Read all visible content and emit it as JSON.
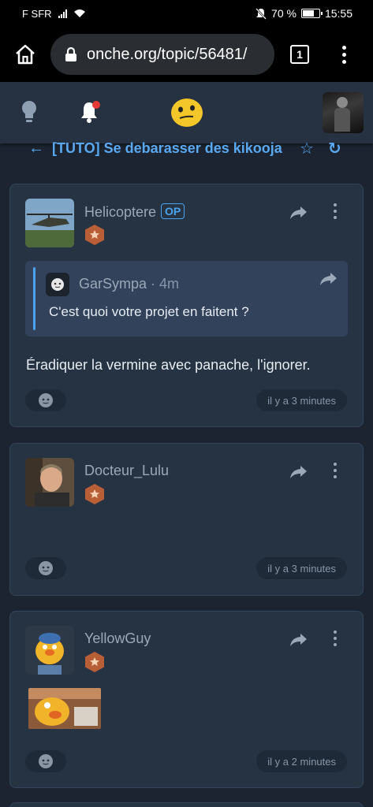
{
  "status_bar": {
    "carrier": "F SFR",
    "battery_percent": "70 %",
    "time": "15:55"
  },
  "browser": {
    "url": "onche.org/topic/56481/",
    "tab_count": "1"
  },
  "topic": {
    "title": "[TUTO] Se debarasser des kikooja"
  },
  "posts": [
    {
      "username": "Helicoptere",
      "op_badge": "OP",
      "quote": {
        "username": "GarSympa",
        "time": "4m",
        "text": "C'est quoi votre projet en faitent ?"
      },
      "body": "Éradiquer la vermine avec panache, l'ignorer.",
      "timestamp": "il y a 3 minutes"
    },
    {
      "username": "Docteur_Lulu",
      "body": "",
      "timestamp": "il y a 3 minutes"
    },
    {
      "username": "YellowGuy",
      "body": "",
      "timestamp": "il y a 2 minutes"
    }
  ],
  "colors": {
    "accent": "#4aa3ee",
    "background": "#1b2430",
    "card": "#263342",
    "rank_badge": "#c0643a"
  }
}
